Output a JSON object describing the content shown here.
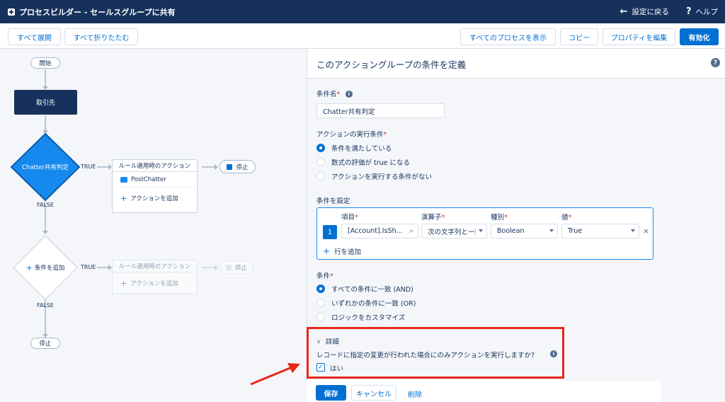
{
  "header": {
    "title": "プロセスビルダー - セールスグループに共有",
    "back_label": "設定に戻る",
    "help_label": "ヘルプ"
  },
  "toolbar": {
    "expand_all": "すべて展開",
    "collapse_all": "すべて折りたたむ",
    "show_all_processes": "すべてのプロセスを表示",
    "copy": "コピー",
    "edit_properties": "プロパティを編集",
    "activate": "有効化"
  },
  "canvas": {
    "start": "開始",
    "object_node": "取引先",
    "criteria1": "Chatter共有判定",
    "true_label": "TRUE",
    "false_label": "FALSE",
    "immediate_actions": "ルール適用時のアクション",
    "action_postchatter": "PostChatter",
    "add_action": "アクションを追加",
    "stop": "停止",
    "add_criteria": "条件を追加"
  },
  "panel": {
    "title": "このアクショングループの条件を定義",
    "criteria_name_label": "条件名",
    "criteria_name_value": "Chatter共有判定",
    "exec_label": "アクションの実行条件",
    "exec_options": [
      {
        "label": "条件を満たしている",
        "selected": true
      },
      {
        "label": "数式の評価が true になる",
        "selected": false
      },
      {
        "label": "アクションを実行する条件がない",
        "selected": false
      }
    ],
    "set_conditions_label": "条件を設定",
    "cond_headers": {
      "field": "項目",
      "operator": "演算子",
      "type": "種別",
      "value": "値"
    },
    "cond_row": {
      "num": "1",
      "field": "[Account].IsSh...",
      "operator": "次の文字列と一致する",
      "type": "Boolean",
      "value": "True"
    },
    "add_row": "行を追加",
    "conditions_label": "条件",
    "logic_options": [
      {
        "label": "すべての条件に一致 (AND)",
        "selected": true
      },
      {
        "label": "いずれかの条件に一致 (OR)",
        "selected": false
      },
      {
        "label": "ロジックをカスタマイズ",
        "selected": false
      }
    ],
    "advanced_label": "詳細",
    "advanced_question": "レコードに指定の変更が行われた場合にのみアクションを実行しますか?",
    "yes_label": "はい",
    "yes_checked": true
  },
  "footer": {
    "save": "保存",
    "cancel": "キャンセル",
    "delete": "削除"
  },
  "colors": {
    "navy": "#16325c",
    "brand": "#0070d2",
    "highlight": "#e8261a"
  }
}
